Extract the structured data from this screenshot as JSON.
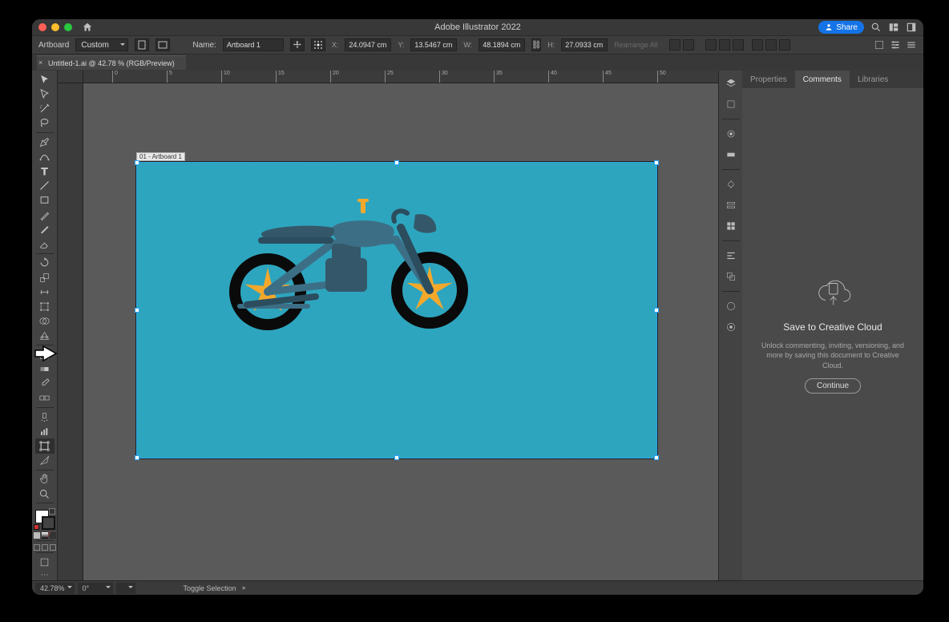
{
  "app": {
    "title": "Adobe Illustrator 2022",
    "share": "Share"
  },
  "ctrl": {
    "artboard_label": "Artboard",
    "preset": "Custom",
    "name_label": "Name:",
    "artboard_name": "Artboard 1",
    "x_label": "X:",
    "x": "24.0947 cm",
    "y_label": "Y:",
    "y": "13.5467 cm",
    "w_label": "W:",
    "w": "48.1894 cm",
    "h_label": "H:",
    "h": "27.0933 cm",
    "rearrange": "Rearrange All"
  },
  "doc": {
    "tab": "Untitled-1.ai @ 42.78 % (RGB/Preview)",
    "artboard_badge": "01 - Artboard 1"
  },
  "ruler": {
    "marks": [
      "0",
      "5",
      "10",
      "15",
      "20",
      "25",
      "30",
      "35",
      "40",
      "45",
      "50"
    ]
  },
  "panels": {
    "tabs": {
      "properties": "Properties",
      "comments": "Comments",
      "libraries": "Libraries"
    },
    "cc_title": "Save to Creative Cloud",
    "cc_sub": "Unlock commenting, inviting, versioning, and more by saving this document to Creative Cloud.",
    "cc_btn": "Continue"
  },
  "status": {
    "zoom": "42.78%",
    "rotate": "0°",
    "mid": "Toggle Selection"
  }
}
